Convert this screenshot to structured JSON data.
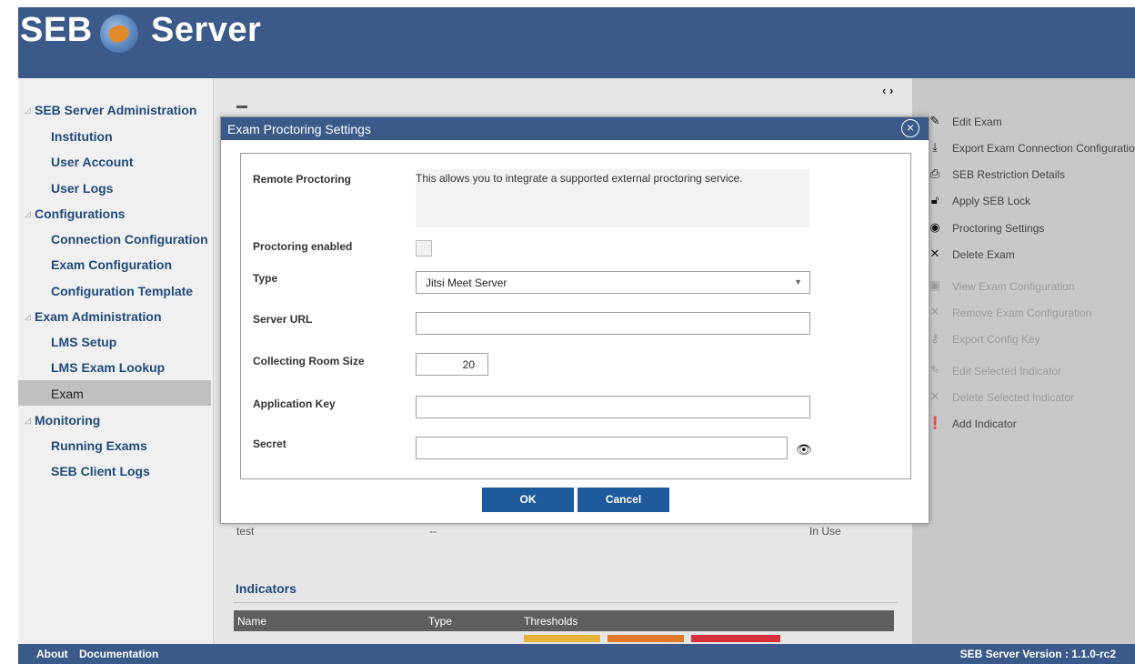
{
  "header": {
    "logo_left": "SEB",
    "logo_right": "Server"
  },
  "nav": {
    "groups": [
      {
        "label": "SEB Server Administration",
        "items": [
          "Institution",
          "User Account",
          "User Logs"
        ]
      },
      {
        "label": "Configurations",
        "items": [
          "Connection Configuration",
          "Exam Configuration",
          "Configuration Template"
        ]
      },
      {
        "label": "Exam Administration",
        "items": [
          "LMS Setup",
          "LMS Exam Lookup",
          "Exam"
        ]
      },
      {
        "label": "Monitoring",
        "items": [
          "Running Exams",
          "SEB Client Logs"
        ]
      }
    ],
    "selected": "Exam"
  },
  "center": {
    "toggle_arrows": "‹ ›",
    "background_row": {
      "name": "test",
      "value": "--",
      "status": "In Use"
    },
    "indicators": {
      "title": "Indicators",
      "columns": [
        "Name",
        "Type",
        "Thresholds"
      ]
    }
  },
  "actions": [
    {
      "label": "Edit Exam",
      "icon": "pencil-icon",
      "enabled": true
    },
    {
      "label": "Export Exam Connection Configuration",
      "icon": "download-icon",
      "enabled": true
    },
    {
      "label": "SEB Restriction Details",
      "icon": "restriction-icon",
      "enabled": true
    },
    {
      "label": "Apply SEB Lock",
      "icon": "lock-icon",
      "enabled": true
    },
    {
      "label": "Proctoring Settings",
      "icon": "proctoring-icon",
      "enabled": true
    },
    {
      "label": "Delete Exam",
      "icon": "x-icon",
      "enabled": true
    },
    {
      "label": "View Exam Configuration",
      "icon": "view-icon",
      "enabled": false
    },
    {
      "label": "Remove Exam Configuration",
      "icon": "x-icon",
      "enabled": false
    },
    {
      "label": "Export Config Key",
      "icon": "key-icon",
      "enabled": false
    },
    {
      "label": "Edit Selected Indicator",
      "icon": "pencil-icon",
      "enabled": false
    },
    {
      "label": "Delete Selected Indicator",
      "icon": "x-icon",
      "enabled": false
    },
    {
      "label": "Add Indicator",
      "icon": "exclamation-icon",
      "enabled": true
    }
  ],
  "dialog": {
    "title": "Exam Proctoring Settings",
    "fields": {
      "remote_proctoring": {
        "label": "Remote Proctoring",
        "description": "This allows you to integrate a supported external proctoring service."
      },
      "proctoring_enabled": {
        "label": "Proctoring enabled",
        "checked": false
      },
      "type": {
        "label": "Type",
        "value": "Jitsi Meet Server"
      },
      "server_url": {
        "label": "Server URL",
        "value": ""
      },
      "collecting_room_size": {
        "label": "Collecting Room Size",
        "value": "20"
      },
      "application_key": {
        "label": "Application Key",
        "value": ""
      },
      "secret": {
        "label": "Secret",
        "value": ""
      }
    },
    "ok_label": "OK",
    "cancel_label": "Cancel"
  },
  "footer": {
    "about": "About",
    "documentation": "Documentation",
    "version": "SEB Server Version : 1.1.0-rc2"
  },
  "colors": {
    "brand": "#3b5a8a",
    "button": "#1f5a9c",
    "nav_text": "#1f4a7c"
  }
}
